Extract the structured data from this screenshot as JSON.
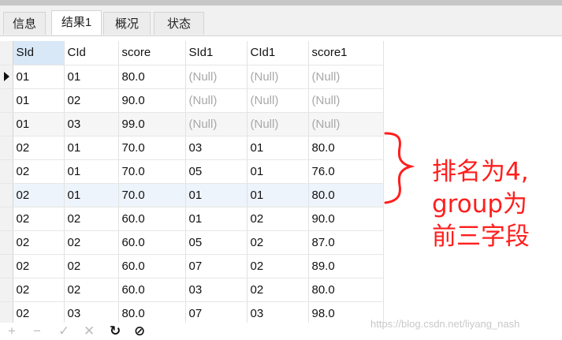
{
  "tabs": [
    {
      "label": "信息"
    },
    {
      "label": "结果1"
    },
    {
      "label": "概况"
    },
    {
      "label": "状态"
    }
  ],
  "table": {
    "columns": [
      "SId",
      "CId",
      "score",
      "SId1",
      "CId1",
      "score1"
    ],
    "rows": [
      [
        "01",
        "01",
        "80.0",
        "(Null)",
        "(Null)",
        "(Null)"
      ],
      [
        "01",
        "02",
        "90.0",
        "(Null)",
        "(Null)",
        "(Null)"
      ],
      [
        "01",
        "03",
        "99.0",
        "(Null)",
        "(Null)",
        "(Null)"
      ],
      [
        "02",
        "01",
        "70.0",
        "03",
        "01",
        "80.0"
      ],
      [
        "02",
        "01",
        "70.0",
        "05",
        "01",
        "76.0"
      ],
      [
        "02",
        "01",
        "70.0",
        "01",
        "01",
        "80.0"
      ],
      [
        "02",
        "02",
        "60.0",
        "01",
        "02",
        "90.0"
      ],
      [
        "02",
        "02",
        "60.0",
        "05",
        "02",
        "87.0"
      ],
      [
        "02",
        "02",
        "60.0",
        "07",
        "02",
        "89.0"
      ],
      [
        "02",
        "02",
        "60.0",
        "03",
        "02",
        "80.0"
      ],
      [
        "02",
        "03",
        "80.0",
        "07",
        "03",
        "98.0"
      ]
    ]
  },
  "annotation": {
    "lines": [
      "排名为4,",
      "group为",
      "前三字段"
    ],
    "color": "#ff1e1e"
  },
  "toolbar": {
    "add": "+",
    "remove": "−",
    "apply": "✓",
    "discard": "✕",
    "refresh": "↻",
    "stop": "⊘"
  },
  "watermark": "https://blog.csdn.net/liyang_nash"
}
